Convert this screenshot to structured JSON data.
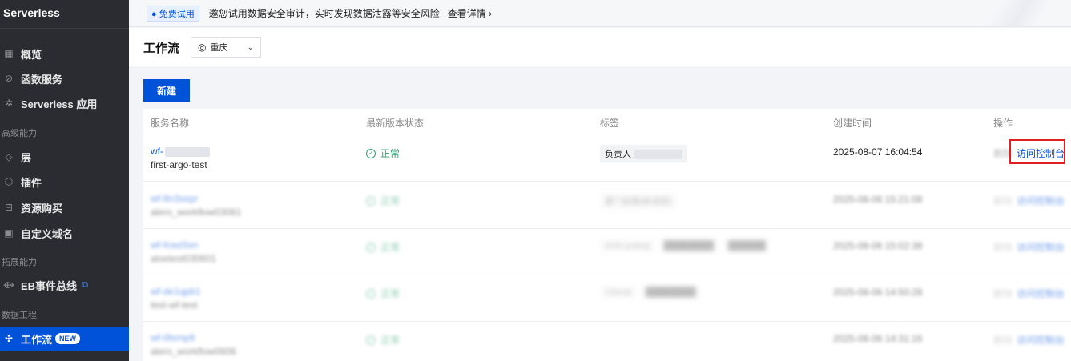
{
  "sidebar": {
    "title": "Serverless",
    "items": [
      {
        "label": "概览",
        "icon": "grid-icon"
      },
      {
        "label": "函数服务",
        "icon": "function-icon"
      },
      {
        "label": "Serverless 应用",
        "icon": "app-icon"
      },
      {
        "label": "层",
        "icon": "layers-icon"
      },
      {
        "label": "插件",
        "icon": "plugin-icon"
      },
      {
        "label": "资源购买",
        "icon": "purchase-icon"
      },
      {
        "label": "自定义域名",
        "icon": "domain-icon"
      },
      {
        "label": "EB事件总线",
        "icon": "eventbus-icon"
      },
      {
        "label": "工作流",
        "icon": "workflow-icon"
      }
    ],
    "groups": [
      "高级能力",
      "拓展能力",
      "数据工程"
    ],
    "new_badge": "NEW"
  },
  "banner": {
    "badge": "免费试用",
    "text": "邀您试用数据安全审计，实时发现数据泄露等安全风险",
    "link": "查看详情 ›"
  },
  "header": {
    "title": "工作流",
    "region": "重庆"
  },
  "toolbar": {
    "new_label": "新建"
  },
  "table": {
    "columns": [
      "服务名称",
      "最新版本状态",
      "标签",
      "创建时间",
      "操作"
    ],
    "rows": [
      {
        "name": "wf-",
        "subname": "first-argo-test",
        "status": "正常",
        "tag": "负责人",
        "created": "2025-08-07 16:04:54",
        "op_delete": "删除",
        "op_visit": "访问控制台"
      },
      {
        "name": "wf-8n3sepr",
        "subname": "alero_workflow03061",
        "status": "正常",
        "tag": "厦门前期(新闻部)",
        "created": "2025-08-06 15:21:08",
        "op_delete": "删除",
        "op_visit": "访问控制台"
      },
      {
        "name": "wf-fcwz5sn",
        "subname": "aloetest030601",
        "status": "正常",
        "tag": "vinin.yuang",
        "created": "2025-08-06 15:02:38",
        "op_delete": "删除",
        "op_visit": "访问控制台"
      },
      {
        "name": "wf-de1qpb1",
        "subname": "test-wf-test",
        "status": "正常",
        "tag": "13ucat",
        "created": "2025-08-06 14:50:28",
        "op_delete": "删除",
        "op_visit": "访问控制台"
      },
      {
        "name": "wf-t9smp9",
        "subname": "alero_workflow0606",
        "status": "正常",
        "tag": "",
        "created": "2025-08-06 14:31:16",
        "op_delete": "删除",
        "op_visit": "访问控制台"
      }
    ]
  },
  "colors": {
    "sidebar_bg": "#2a2c31",
    "accent": "#0052d9",
    "success": "#2ba471",
    "highlight": "#e02020"
  }
}
